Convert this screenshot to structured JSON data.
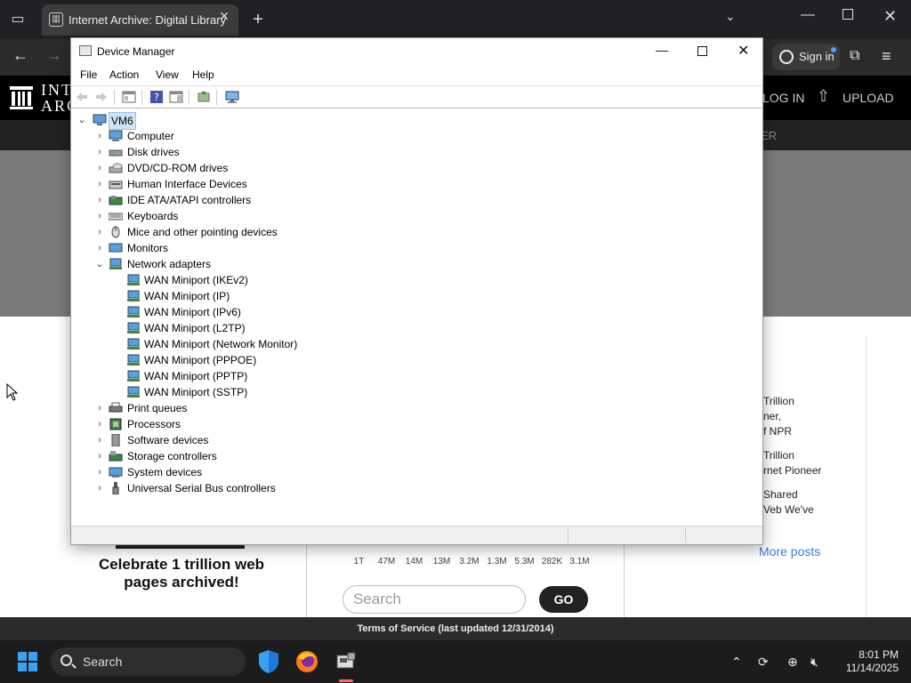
{
  "browser": {
    "tab_title": "Internet Archive: Digital Library",
    "signin_label": "Sign in"
  },
  "ia": {
    "logo_text": "INT\nARC",
    "login": "LOG IN",
    "upload": "UPLOAD",
    "subnav_text": "ER",
    "blog_lines": [
      "Trillion",
      "ner,",
      "f NPR",
      "Trillion",
      "rnet Pioneer",
      "Shared",
      "Veb We've"
    ],
    "more_posts": "More posts",
    "celebrate": "Celebrate 1 trillion web pages archived!",
    "counts": [
      "1T",
      "47M",
      "14M",
      "13M",
      "3.2M",
      "1.3M",
      "5.3M",
      "282K",
      "3.1M"
    ],
    "search_placeholder": "Search",
    "go": "GO",
    "tos": "Terms of Service (last updated 12/31/2014)"
  },
  "device_manager": {
    "title": "Device Manager",
    "menu": [
      "File",
      "Action",
      "View",
      "Help"
    ],
    "root": "VM6",
    "categories": [
      {
        "label": "Computer",
        "icon": "computer-icon",
        "expanded": false
      },
      {
        "label": "Disk drives",
        "icon": "disk-drive-icon",
        "expanded": false
      },
      {
        "label": "DVD/CD-ROM drives",
        "icon": "dvd-drive-icon",
        "expanded": false
      },
      {
        "label": "Human Interface Devices",
        "icon": "hid-icon",
        "expanded": false
      },
      {
        "label": "IDE ATA/ATAPI controllers",
        "icon": "ide-controller-icon",
        "expanded": false
      },
      {
        "label": "Keyboards",
        "icon": "keyboard-icon",
        "expanded": false
      },
      {
        "label": "Mice and other pointing devices",
        "icon": "mouse-icon",
        "expanded": false
      },
      {
        "label": "Monitors",
        "icon": "monitor-icon",
        "expanded": false
      },
      {
        "label": "Network adapters",
        "icon": "network-adapter-icon",
        "expanded": true,
        "children": [
          "WAN Miniport (IKEv2)",
          "WAN Miniport (IP)",
          "WAN Miniport (IPv6)",
          "WAN Miniport (L2TP)",
          "WAN Miniport (Network Monitor)",
          "WAN Miniport (PPPOE)",
          "WAN Miniport (PPTP)",
          "WAN Miniport (SSTP)"
        ]
      },
      {
        "label": "Print queues",
        "icon": "printer-icon",
        "expanded": false
      },
      {
        "label": "Processors",
        "icon": "processor-icon",
        "expanded": false
      },
      {
        "label": "Software devices",
        "icon": "software-device-icon",
        "expanded": false
      },
      {
        "label": "Storage controllers",
        "icon": "storage-controller-icon",
        "expanded": false
      },
      {
        "label": "System devices",
        "icon": "system-device-icon",
        "expanded": false
      },
      {
        "label": "Universal Serial Bus controllers",
        "icon": "usb-icon",
        "expanded": false
      }
    ]
  },
  "taskbar": {
    "search_label": "Search",
    "time": "8:01 PM",
    "date": "11/14/2025"
  }
}
